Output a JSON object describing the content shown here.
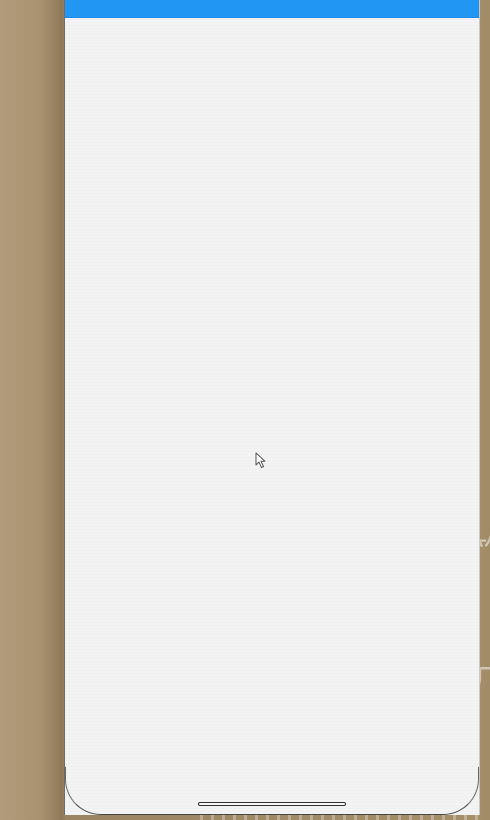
{
  "desktop": {
    "scribble_text": "⺮\n·\n丌"
  },
  "app": {
    "status_bar_color": "#2196f3",
    "background_color": "#f3f3f3"
  },
  "icons": {
    "cursor": "mouse-pointer-icon",
    "home": "home-indicator-bar"
  }
}
